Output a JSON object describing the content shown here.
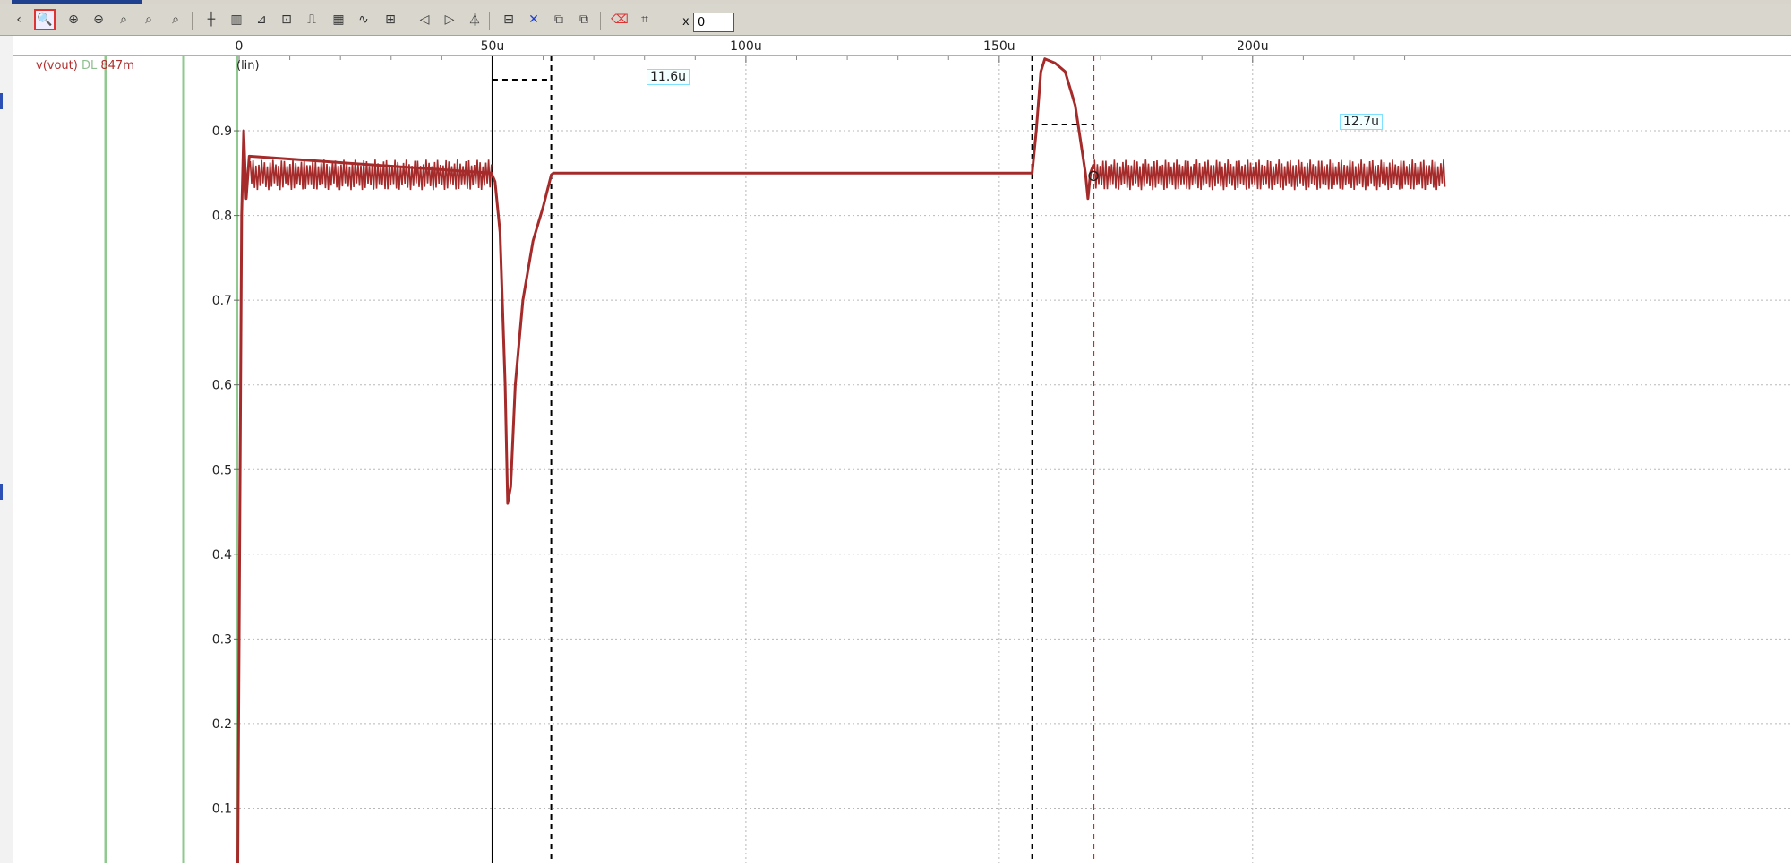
{
  "toolbar": {
    "x_label": "x",
    "x_value": "0",
    "icons": [
      "zoom-fit-icon",
      "zoom-in-icon",
      "zoom-out-icon",
      "zoom-x-icon",
      "zoom-y-icon",
      "zoom-previous-icon",
      "cursor-icon",
      "bars-icon",
      "measure-icon",
      "label-icon",
      "pulse-icon",
      "grid-icon",
      "wave-icon",
      "fft-icon",
      "previous-icon",
      "next-icon",
      "marker-icon",
      "export-icon",
      "delete-icon",
      "copy-icon",
      "paste-icon",
      "eraser-icon",
      "fit-window-icon"
    ]
  },
  "trace": {
    "name": "v(vout)",
    "dl": "DL",
    "value": "847m",
    "color": "#a52a2a"
  },
  "axis": {
    "scale": "(lin)"
  },
  "measurements": {
    "dip_width": "11.6u",
    "peak_width": "12.7u"
  },
  "chart_data": {
    "type": "line",
    "x_unit": "u",
    "x_ticks": [
      "0",
      "50u",
      "100u",
      "150u",
      "200u"
    ],
    "y_ticks": [
      "0.1",
      "0.2",
      "0.3",
      "0.4",
      "0.5",
      "0.6",
      "0.7",
      "0.8",
      "0.9"
    ],
    "xlim": [
      0,
      238
    ],
    "ylim": [
      0,
      1.0
    ],
    "grid": true,
    "series": [
      {
        "name": "v(vout)",
        "color": "#a52a2a",
        "ripple_band": [
          [
            2,
            18
          ],
          [
            175,
            238
          ]
        ],
        "points": [
          [
            -0.3,
            0.0
          ],
          [
            0.2,
            0.5
          ],
          [
            0.5,
            0.8
          ],
          [
            0.9,
            0.9
          ],
          [
            1.4,
            0.82
          ],
          [
            2,
            0.87
          ],
          [
            49.8,
            0.85
          ],
          [
            50.5,
            0.84
          ],
          [
            51.5,
            0.78
          ],
          [
            52.5,
            0.6
          ],
          [
            53.0,
            0.46
          ],
          [
            53.6,
            0.48
          ],
          [
            54.5,
            0.6
          ],
          [
            56,
            0.7
          ],
          [
            58,
            0.77
          ],
          [
            60,
            0.81
          ],
          [
            61.6,
            0.848
          ],
          [
            62,
            0.85
          ],
          [
            156.5,
            0.85
          ],
          [
            157.3,
            0.9
          ],
          [
            158.2,
            0.97
          ],
          [
            159,
            0.985
          ],
          [
            161,
            0.98
          ],
          [
            163,
            0.97
          ],
          [
            165,
            0.93
          ],
          [
            167,
            0.85
          ],
          [
            167.5,
            0.82
          ],
          [
            168,
            0.85
          ],
          [
            168.6,
            0.86
          ]
        ]
      }
    ],
    "cursors": [
      {
        "x": 50.0,
        "style": "solid",
        "color": "#000000"
      },
      {
        "x": 61.6,
        "style": "dashed",
        "color": "#000000"
      },
      {
        "x": 156.5,
        "style": "dashed",
        "color": "#000000"
      },
      {
        "x": 168.6,
        "style": "dashed",
        "color": "#dd2222"
      }
    ]
  }
}
